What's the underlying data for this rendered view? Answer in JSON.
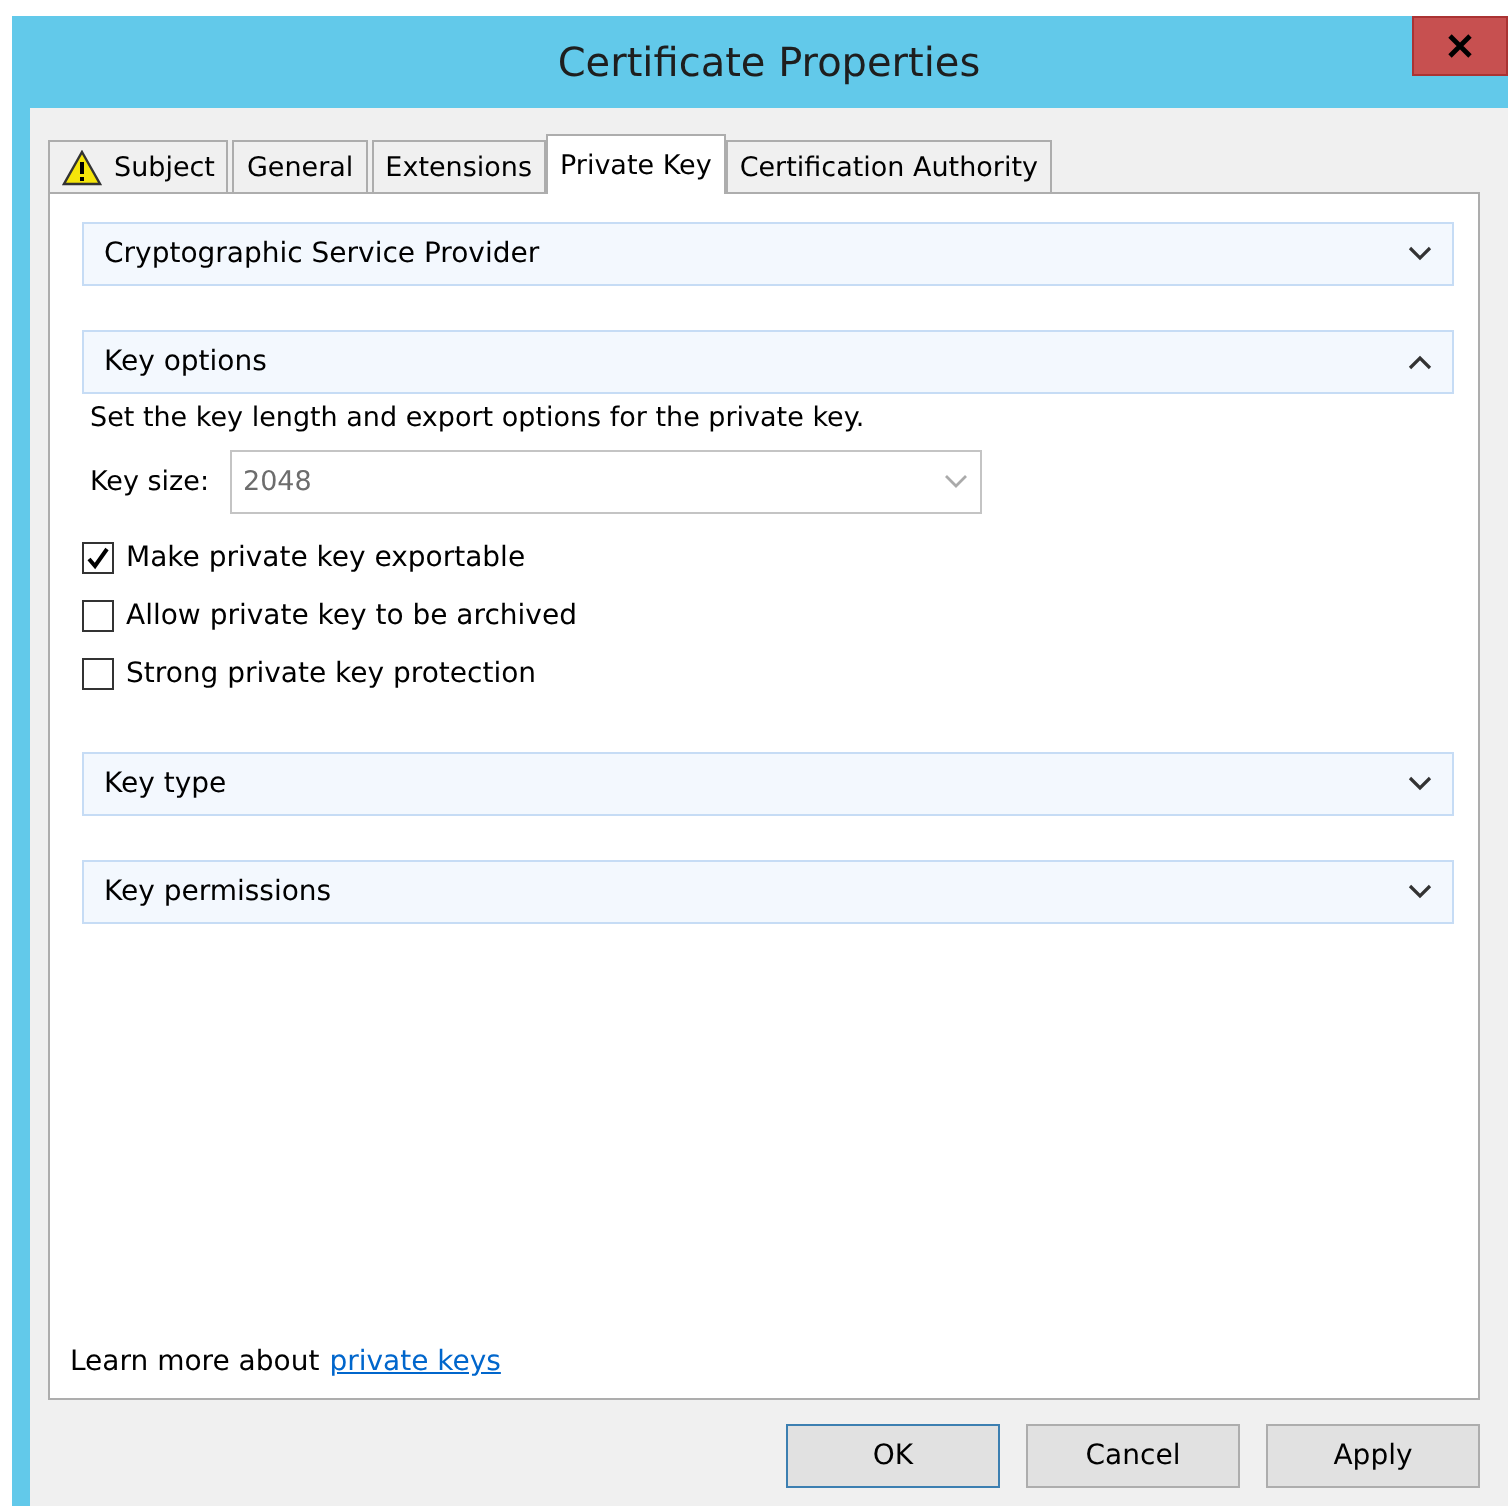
{
  "window": {
    "title": "Certificate Properties"
  },
  "tabs": [
    {
      "label": "Subject",
      "warning": true,
      "selected": false
    },
    {
      "label": "General",
      "warning": false,
      "selected": false
    },
    {
      "label": "Extensions",
      "warning": false,
      "selected": false
    },
    {
      "label": "Private Key",
      "warning": false,
      "selected": true
    },
    {
      "label": "Certification Authority",
      "warning": false,
      "selected": false
    }
  ],
  "sections": [
    {
      "title": "Cryptographic Service Provider",
      "expanded": false
    },
    {
      "title": "Key options",
      "expanded": true,
      "description": "Set the key length and export options for the private key.",
      "key_size": {
        "label": "Key size:",
        "value": "2048",
        "disabled": true
      },
      "options": [
        {
          "label": "Make private key exportable",
          "checked": true
        },
        {
          "label": "Allow private key to be archived",
          "checked": false
        },
        {
          "label": "Strong private key protection",
          "checked": false
        }
      ]
    },
    {
      "title": "Key type",
      "expanded": false
    },
    {
      "title": "Key permissions",
      "expanded": false
    }
  ],
  "footer": {
    "text": "Learn more about",
    "link": "private keys"
  },
  "buttons": [
    {
      "label": "OK",
      "default": true
    },
    {
      "label": "Cancel",
      "default": false
    },
    {
      "label": "Apply",
      "default": false
    }
  ]
}
